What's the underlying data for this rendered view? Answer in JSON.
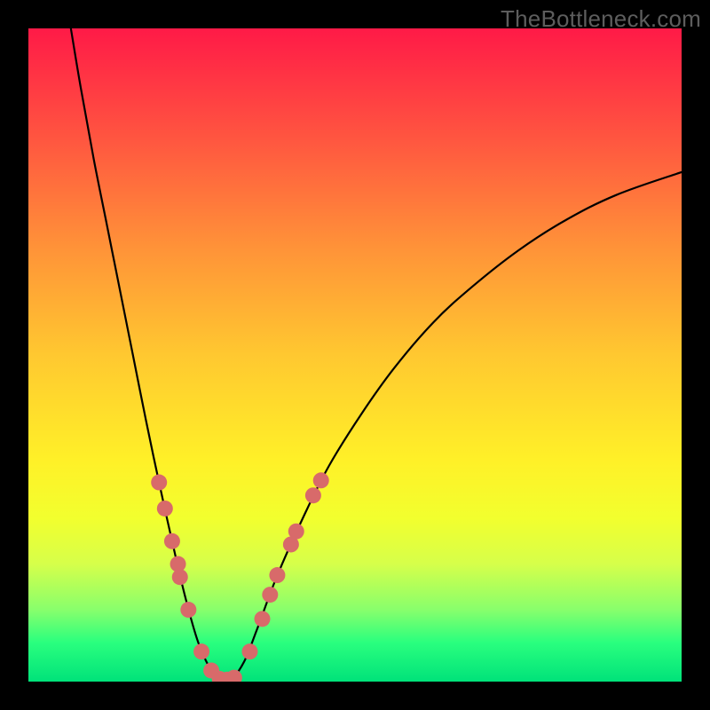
{
  "watermark": "TheBottleneck.com",
  "chart_data": {
    "type": "line",
    "title": "",
    "xlabel": "",
    "ylabel": "",
    "xlim": [
      0,
      100
    ],
    "ylim": [
      0,
      100
    ],
    "grid": false,
    "legend": false,
    "background_gradient": {
      "orientation": "vertical",
      "stops": [
        {
          "pos": 0.0,
          "color": "#ff1a47"
        },
        {
          "pos": 0.17,
          "color": "#ff5640"
        },
        {
          "pos": 0.34,
          "color": "#ff9438"
        },
        {
          "pos": 0.5,
          "color": "#ffc830"
        },
        {
          "pos": 0.66,
          "color": "#fff028"
        },
        {
          "pos": 0.75,
          "color": "#f2ff2e"
        },
        {
          "pos": 0.82,
          "color": "#d6ff4a"
        },
        {
          "pos": 0.89,
          "color": "#88ff6c"
        },
        {
          "pos": 0.94,
          "color": "#2aff7e"
        },
        {
          "pos": 1.0,
          "color": "#00e27a"
        }
      ]
    },
    "series": [
      {
        "name": "curve",
        "color": "#000000",
        "points": [
          {
            "x": 6.5,
            "y": 100.0
          },
          {
            "x": 8.0,
            "y": 91.0
          },
          {
            "x": 10.0,
            "y": 80.0
          },
          {
            "x": 12.0,
            "y": 70.0
          },
          {
            "x": 14.0,
            "y": 60.0
          },
          {
            "x": 16.0,
            "y": 50.0
          },
          {
            "x": 18.0,
            "y": 40.0
          },
          {
            "x": 20.0,
            "y": 30.5
          },
          {
            "x": 22.0,
            "y": 21.5
          },
          {
            "x": 24.0,
            "y": 13.0
          },
          {
            "x": 26.0,
            "y": 6.0
          },
          {
            "x": 28.0,
            "y": 1.7
          },
          {
            "x": 29.5,
            "y": 0.3
          },
          {
            "x": 31.0,
            "y": 0.3
          },
          {
            "x": 33.0,
            "y": 3.0
          },
          {
            "x": 35.0,
            "y": 8.0
          },
          {
            "x": 38.0,
            "y": 16.0
          },
          {
            "x": 42.0,
            "y": 25.0
          },
          {
            "x": 46.0,
            "y": 33.0
          },
          {
            "x": 51.0,
            "y": 41.0
          },
          {
            "x": 56.0,
            "y": 48.0
          },
          {
            "x": 62.0,
            "y": 55.0
          },
          {
            "x": 68.0,
            "y": 60.5
          },
          {
            "x": 75.0,
            "y": 66.0
          },
          {
            "x": 82.0,
            "y": 70.5
          },
          {
            "x": 90.0,
            "y": 74.5
          },
          {
            "x": 100.0,
            "y": 78.0
          }
        ]
      }
    ],
    "markers": [
      {
        "x": 20.0,
        "y": 30.5,
        "color": "#d86a6a",
        "r": 9
      },
      {
        "x": 20.9,
        "y": 26.5,
        "color": "#d86a6a",
        "r": 9
      },
      {
        "x": 22.0,
        "y": 21.5,
        "color": "#d86a6a",
        "r": 9
      },
      {
        "x": 22.9,
        "y": 18.0,
        "color": "#d86a6a",
        "r": 9
      },
      {
        "x": 23.2,
        "y": 16.0,
        "color": "#d86a6a",
        "r": 9
      },
      {
        "x": 24.5,
        "y": 11.0,
        "color": "#d86a6a",
        "r": 9
      },
      {
        "x": 26.5,
        "y": 4.6,
        "color": "#d86a6a",
        "r": 9
      },
      {
        "x": 28.0,
        "y": 1.7,
        "color": "#d86a6a",
        "r": 9
      },
      {
        "x": 29.3,
        "y": 0.4,
        "color": "#d86a6a",
        "r": 9
      },
      {
        "x": 30.4,
        "y": 0.3,
        "color": "#d86a6a",
        "r": 9
      },
      {
        "x": 31.5,
        "y": 0.6,
        "color": "#d86a6a",
        "r": 9
      },
      {
        "x": 33.9,
        "y": 4.6,
        "color": "#d86a6a",
        "r": 9
      },
      {
        "x": 35.8,
        "y": 9.6,
        "color": "#d86a6a",
        "r": 9
      },
      {
        "x": 37.0,
        "y": 13.3,
        "color": "#d86a6a",
        "r": 9
      },
      {
        "x": 38.1,
        "y": 16.3,
        "color": "#d86a6a",
        "r": 9
      },
      {
        "x": 40.2,
        "y": 21.0,
        "color": "#d86a6a",
        "r": 9
      },
      {
        "x": 41.0,
        "y": 23.0,
        "color": "#d86a6a",
        "r": 9
      },
      {
        "x": 43.6,
        "y": 28.5,
        "color": "#d86a6a",
        "r": 9
      },
      {
        "x": 44.8,
        "y": 30.8,
        "color": "#d86a6a",
        "r": 9
      }
    ]
  }
}
